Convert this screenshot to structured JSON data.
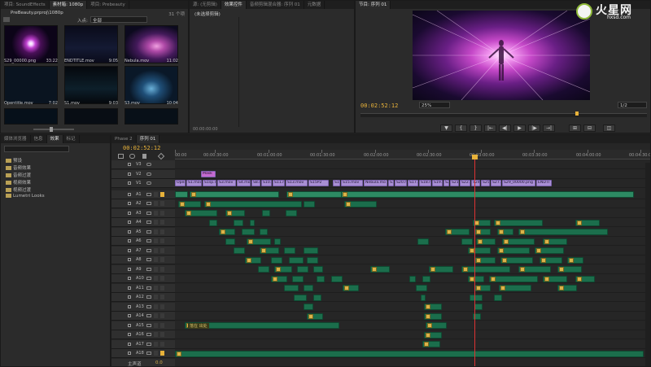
{
  "project": {
    "tabs": [
      {
        "label": "项目: SoundEffects",
        "active": false
      },
      {
        "label": "素材箱: 1080p",
        "active": true
      },
      {
        "label": "项目: Prebeauty",
        "active": false
      }
    ],
    "count": "31 个项",
    "path": "PreBeauty.prproj\\1080p",
    "in_label": "入点:",
    "in_value": "全部",
    "items": [
      {
        "name": "S29_00000.png",
        "dur": "33:22"
      },
      {
        "name": "ENDTITLE.mov",
        "dur": "9:05"
      },
      {
        "name": "Nebula.mov",
        "dur": "11:02"
      },
      {
        "name": "Opentitle.mov",
        "dur": "7:02"
      },
      {
        "name": "S1.mov",
        "dur": "9:03"
      },
      {
        "name": "S3.mov",
        "dur": "10:04"
      }
    ]
  },
  "source": {
    "tabs": [
      {
        "label": "源: (无剪辑)",
        "active": false
      },
      {
        "label": "效果控件",
        "active": true
      },
      {
        "label": "音频剪辑混合器: 序列 01",
        "active": false
      },
      {
        "label": "元数据",
        "active": false
      }
    ],
    "message": "(未选择剪辑)",
    "timecode": "00:00:00:00"
  },
  "program": {
    "tabs": [
      {
        "label": "节目: 序列 01",
        "active": true
      }
    ],
    "timecode": "00:02:52:12",
    "zoom": "25%",
    "quality": "1/2",
    "transport": [
      "▼",
      "{",
      "}",
      "|←",
      "◀|",
      "▶",
      "|▶",
      "→|",
      "⊞",
      "⊟",
      "◫"
    ]
  },
  "effects": {
    "tabs": [
      {
        "label": "媒体浏览器",
        "active": false
      },
      {
        "label": "信息",
        "active": false
      },
      {
        "label": "效果",
        "active": true
      },
      {
        "label": "标记",
        "active": false
      }
    ],
    "items": [
      "预设",
      "音频效果",
      "音频过渡",
      "视频效果",
      "视频过渡",
      "Lumetri Looks"
    ]
  },
  "timeline": {
    "tabs": [
      {
        "label": "Phase 2",
        "active": false
      },
      {
        "label": "序列 01",
        "active": true
      }
    ],
    "timecode": "00:02:52:12",
    "ruler": [
      "00:00",
      "00:00:30:00",
      "00:01:00:00",
      "00:01:30:00",
      "00:02:00:00",
      "00:02:30:00",
      "00:03:00:00",
      "00:03:30:00",
      "00:04:00:00",
      "00:04:30:00"
    ],
    "video_tracks": [
      "V3",
      "V2",
      "V1"
    ],
    "audio_tracks": [
      "A1",
      "A2",
      "A3",
      "A4",
      "A5",
      "A6",
      "A7",
      "A8",
      "A9",
      "A10",
      "A11",
      "A12",
      "A13",
      "A14",
      "A15",
      "A16",
      "A17",
      "A18"
    ],
    "master_label": "主声道",
    "master_value": "0.0",
    "mask_label": "Mask",
    "v1_clips": [
      "Open",
      "S1.mov",
      "S1sp.m",
      "S3.mov",
      "S4.mov",
      "S8.m",
      "S10.m",
      "S11.m",
      "S13.mov",
      "S15P2",
      "S1",
      "S15.mov",
      "Nebula.mo",
      "S1",
      "S20.m",
      "S17.r",
      "S18.m",
      "S19.m",
      "S2",
      "S21.m",
      "S22.r",
      "S24.r",
      "S25.r",
      "S27.mo",
      "S29_00000.png",
      "ENDTI"
    ],
    "a15_label": "落在 出处"
  },
  "watermark": {
    "text": "火星网",
    "sub": "hxsd.com"
  }
}
